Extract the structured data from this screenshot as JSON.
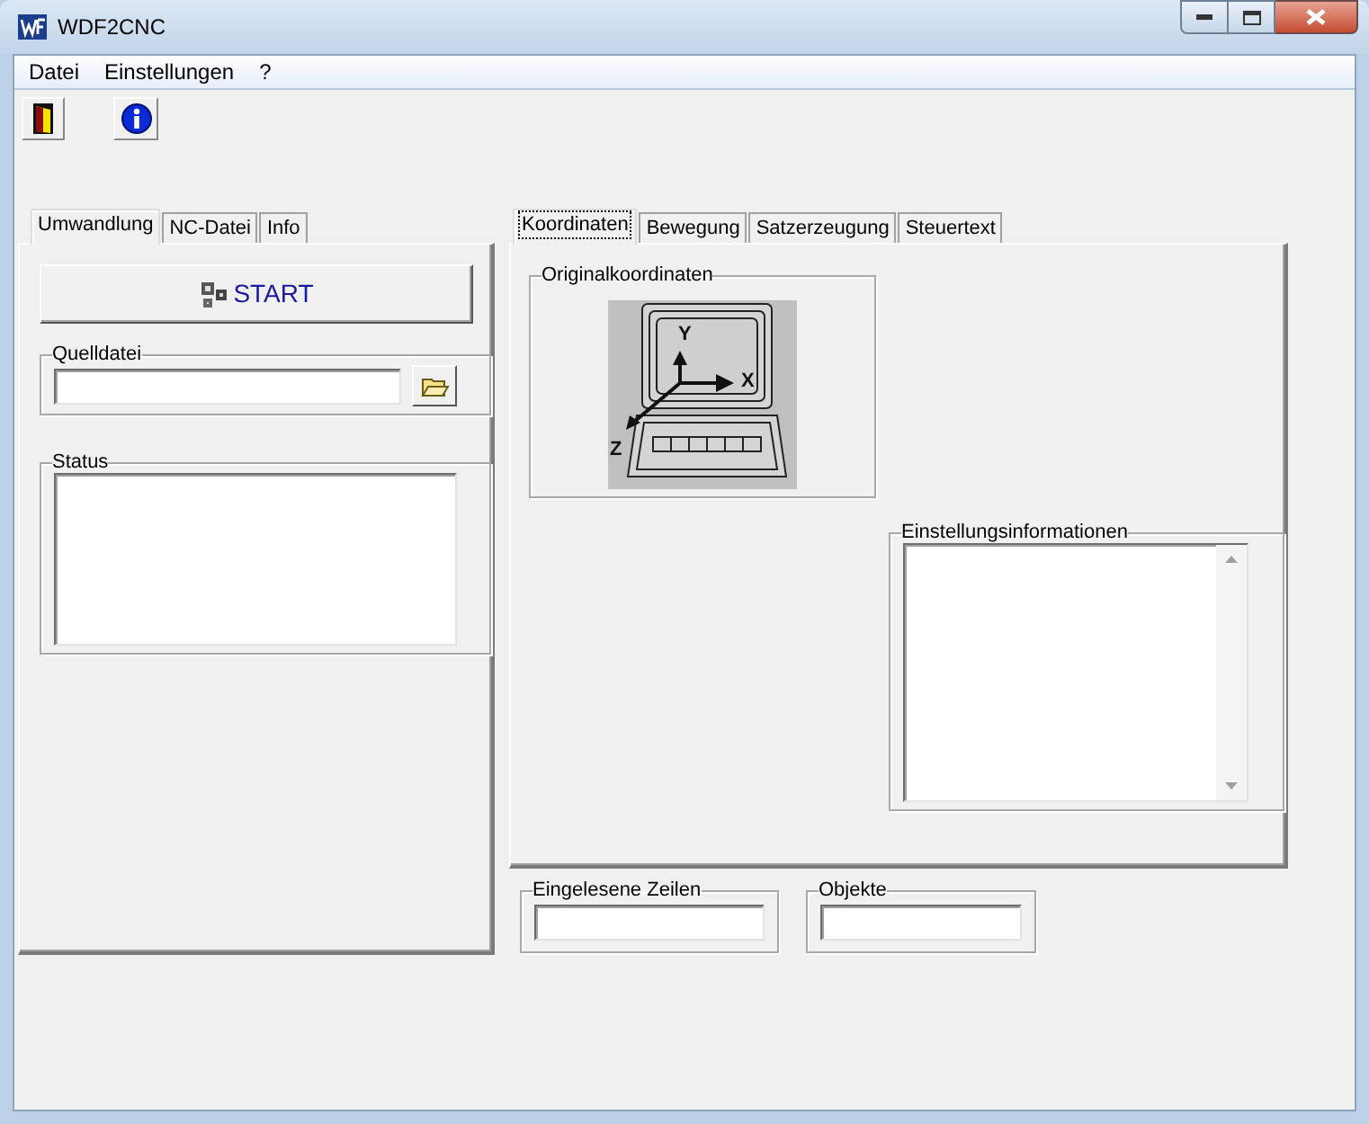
{
  "window": {
    "title": "WDF2CNC"
  },
  "menu": [
    "Datei",
    "Einstellungen",
    "?"
  ],
  "left_tabs": [
    {
      "label": "Umwandlung",
      "selected": true
    },
    {
      "label": "NC-Datei",
      "selected": false
    },
    {
      "label": "Info",
      "selected": false
    }
  ],
  "start_button": {
    "label": "START"
  },
  "source_file": {
    "label": "Quelldatei"
  },
  "status": {
    "label": "Status"
  },
  "right_tabs": [
    {
      "label": "Koordinaten",
      "selected": true
    },
    {
      "label": "Bewegung",
      "selected": false
    },
    {
      "label": "Satzerzeugung",
      "selected": false
    },
    {
      "label": "Steuertext",
      "selected": false
    }
  ],
  "coordinates": {
    "label": "Originalkoordinaten",
    "axes": [
      "Y",
      "X",
      "Z"
    ]
  },
  "settings_info": {
    "label": "Einstellungsinformationen"
  },
  "read_lines": {
    "label": "Eingelesene Zeilen"
  },
  "objects": {
    "label": "Objekte"
  }
}
